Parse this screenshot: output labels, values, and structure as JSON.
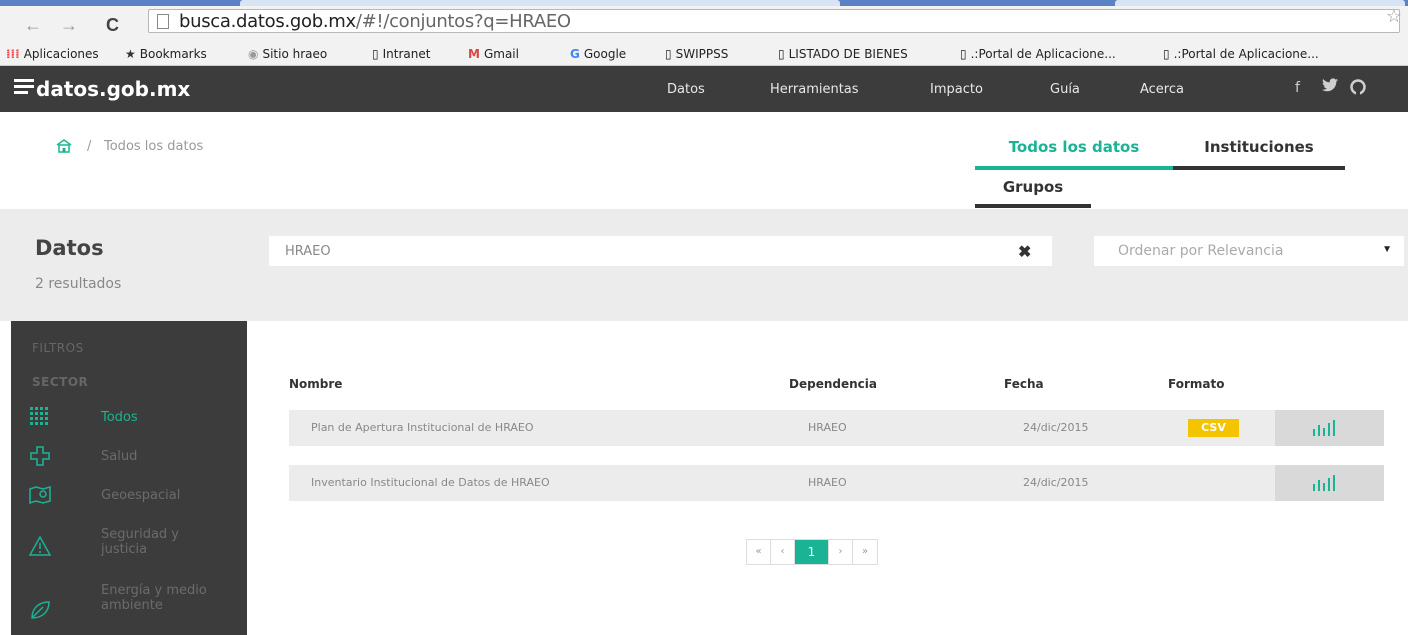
{
  "browser": {
    "url_host": "busca.datos.gob.mx",
    "url_path": "/#!/conjuntos?q=HRAEO",
    "bookmarks": [
      "Aplicaciones",
      "Bookmarks",
      "Sitio hraeo",
      "Intranet",
      "Gmail",
      "Google",
      "SWIPPSS",
      "LISTADO DE BIENES",
      ".:Portal de Aplicacione...",
      ".:Portal de Aplicacione..."
    ]
  },
  "header": {
    "logo": "datos.gob.mx",
    "nav": [
      "Datos",
      "Herramientas",
      "Impacto",
      "Guía",
      "Acerca"
    ],
    "social": [
      "f"
    ]
  },
  "breadcrumb": {
    "separator": "/",
    "current": "Todos los datos"
  },
  "tabs": {
    "todos": "Todos los datos",
    "instituciones": "Instituciones",
    "grupos": "Grupos"
  },
  "search": {
    "title": "Datos",
    "results": "2 resultados",
    "query": "HRAEO",
    "sort_label": "Ordenar por Relevancia"
  },
  "sidebar": {
    "filters_heading": "FILTROS",
    "sector_heading": "SECTOR",
    "items": [
      {
        "label": "Todos",
        "icon": "grid-icon"
      },
      {
        "label": "Salud",
        "icon": "health-cross-icon"
      },
      {
        "label": "Geoespacial",
        "icon": "map-icon"
      },
      {
        "label": "Seguridad y justicia",
        "icon": "warning-icon"
      },
      {
        "label": "Energía y medio ambiente",
        "icon": "leaf-icon"
      }
    ]
  },
  "table": {
    "headers": {
      "nombre": "Nombre",
      "dependencia": "Dependencia",
      "fecha": "Fecha",
      "formato": "Formato"
    },
    "rows": [
      {
        "nombre": "Plan de Apertura Institucional de HRAEO",
        "dependencia": "HRAEO",
        "fecha": "24/dic/2015",
        "formato": "CSV"
      },
      {
        "nombre": "Inventario Institucional de Datos de HRAEO",
        "dependencia": "HRAEO",
        "fecha": "24/dic/2015",
        "formato": ""
      }
    ]
  },
  "pagination": {
    "first": "«",
    "prev": "‹",
    "current": "1",
    "next": "›",
    "last": "»"
  },
  "colors": {
    "accent": "#1ab394",
    "header_bg": "#3c3c3c",
    "csv_badge": "#f5c400"
  }
}
